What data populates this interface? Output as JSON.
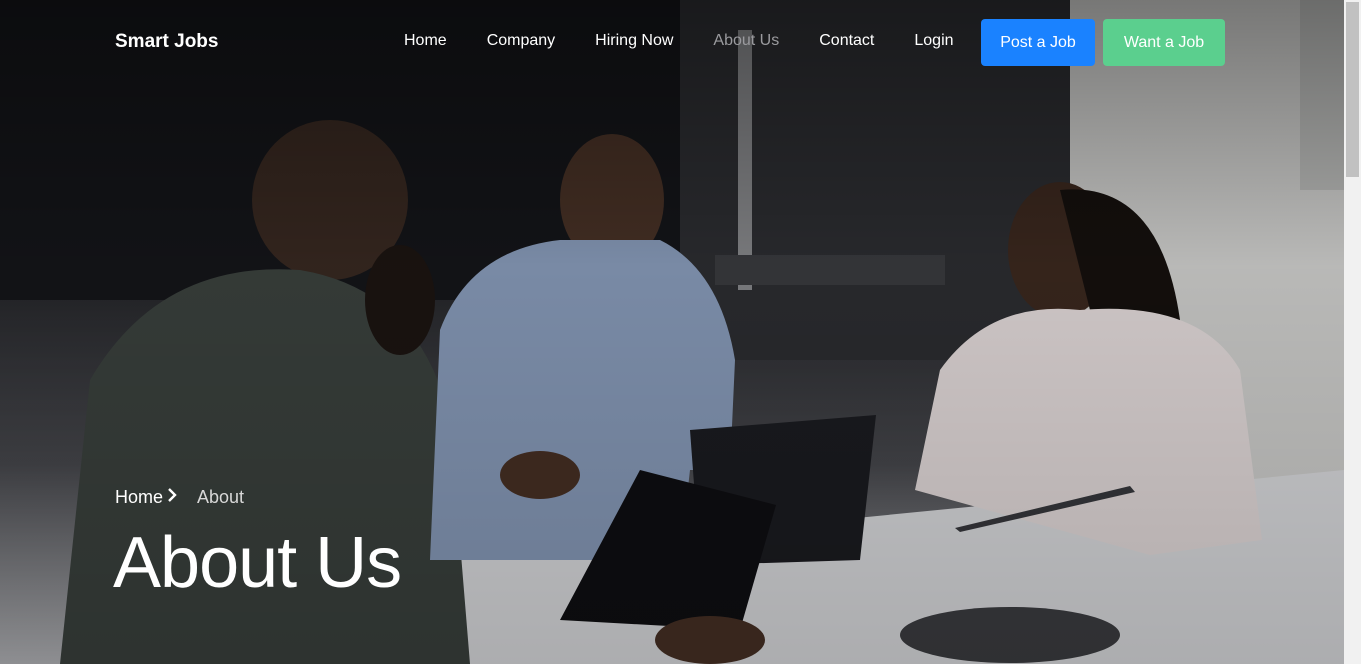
{
  "brand": {
    "name": "Smart Jobs"
  },
  "nav": {
    "links": [
      {
        "label": "Home"
      },
      {
        "label": "Company"
      },
      {
        "label": "Hiring Now"
      },
      {
        "label": "About Us"
      },
      {
        "label": "Contact"
      },
      {
        "label": "Login"
      }
    ],
    "active": "About Us",
    "post_job_label": "Post a Job",
    "want_job_label": "Want a Job"
  },
  "breadcrumb": {
    "home": "Home",
    "current": "About"
  },
  "hero": {
    "title": "About Us"
  },
  "colors": {
    "post_button": "#1a82ff",
    "want_button": "#5bcf8e",
    "active_link": "#9a9a9e"
  }
}
